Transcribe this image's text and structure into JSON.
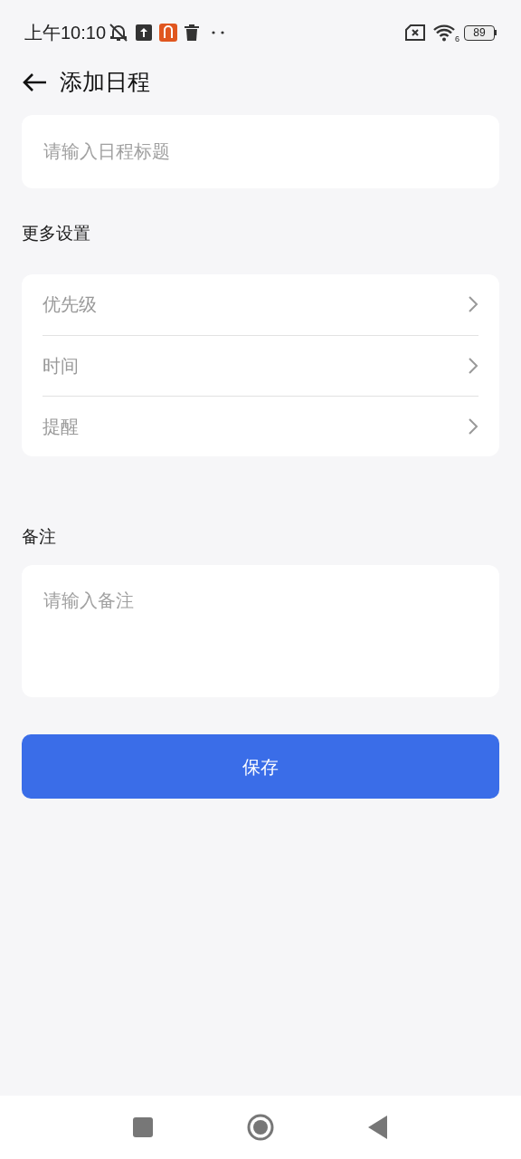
{
  "status_bar": {
    "time": "上午10:10",
    "wifi_label": "6",
    "battery": "89"
  },
  "header": {
    "title": "添加日程"
  },
  "title_field": {
    "placeholder": "请输入日程标题"
  },
  "more_settings": {
    "heading": "更多设置",
    "items": [
      {
        "label": "优先级"
      },
      {
        "label": "时间"
      },
      {
        "label": "提醒"
      }
    ]
  },
  "notes": {
    "heading": "备注",
    "placeholder": "请输入备注"
  },
  "save_button": "保存"
}
